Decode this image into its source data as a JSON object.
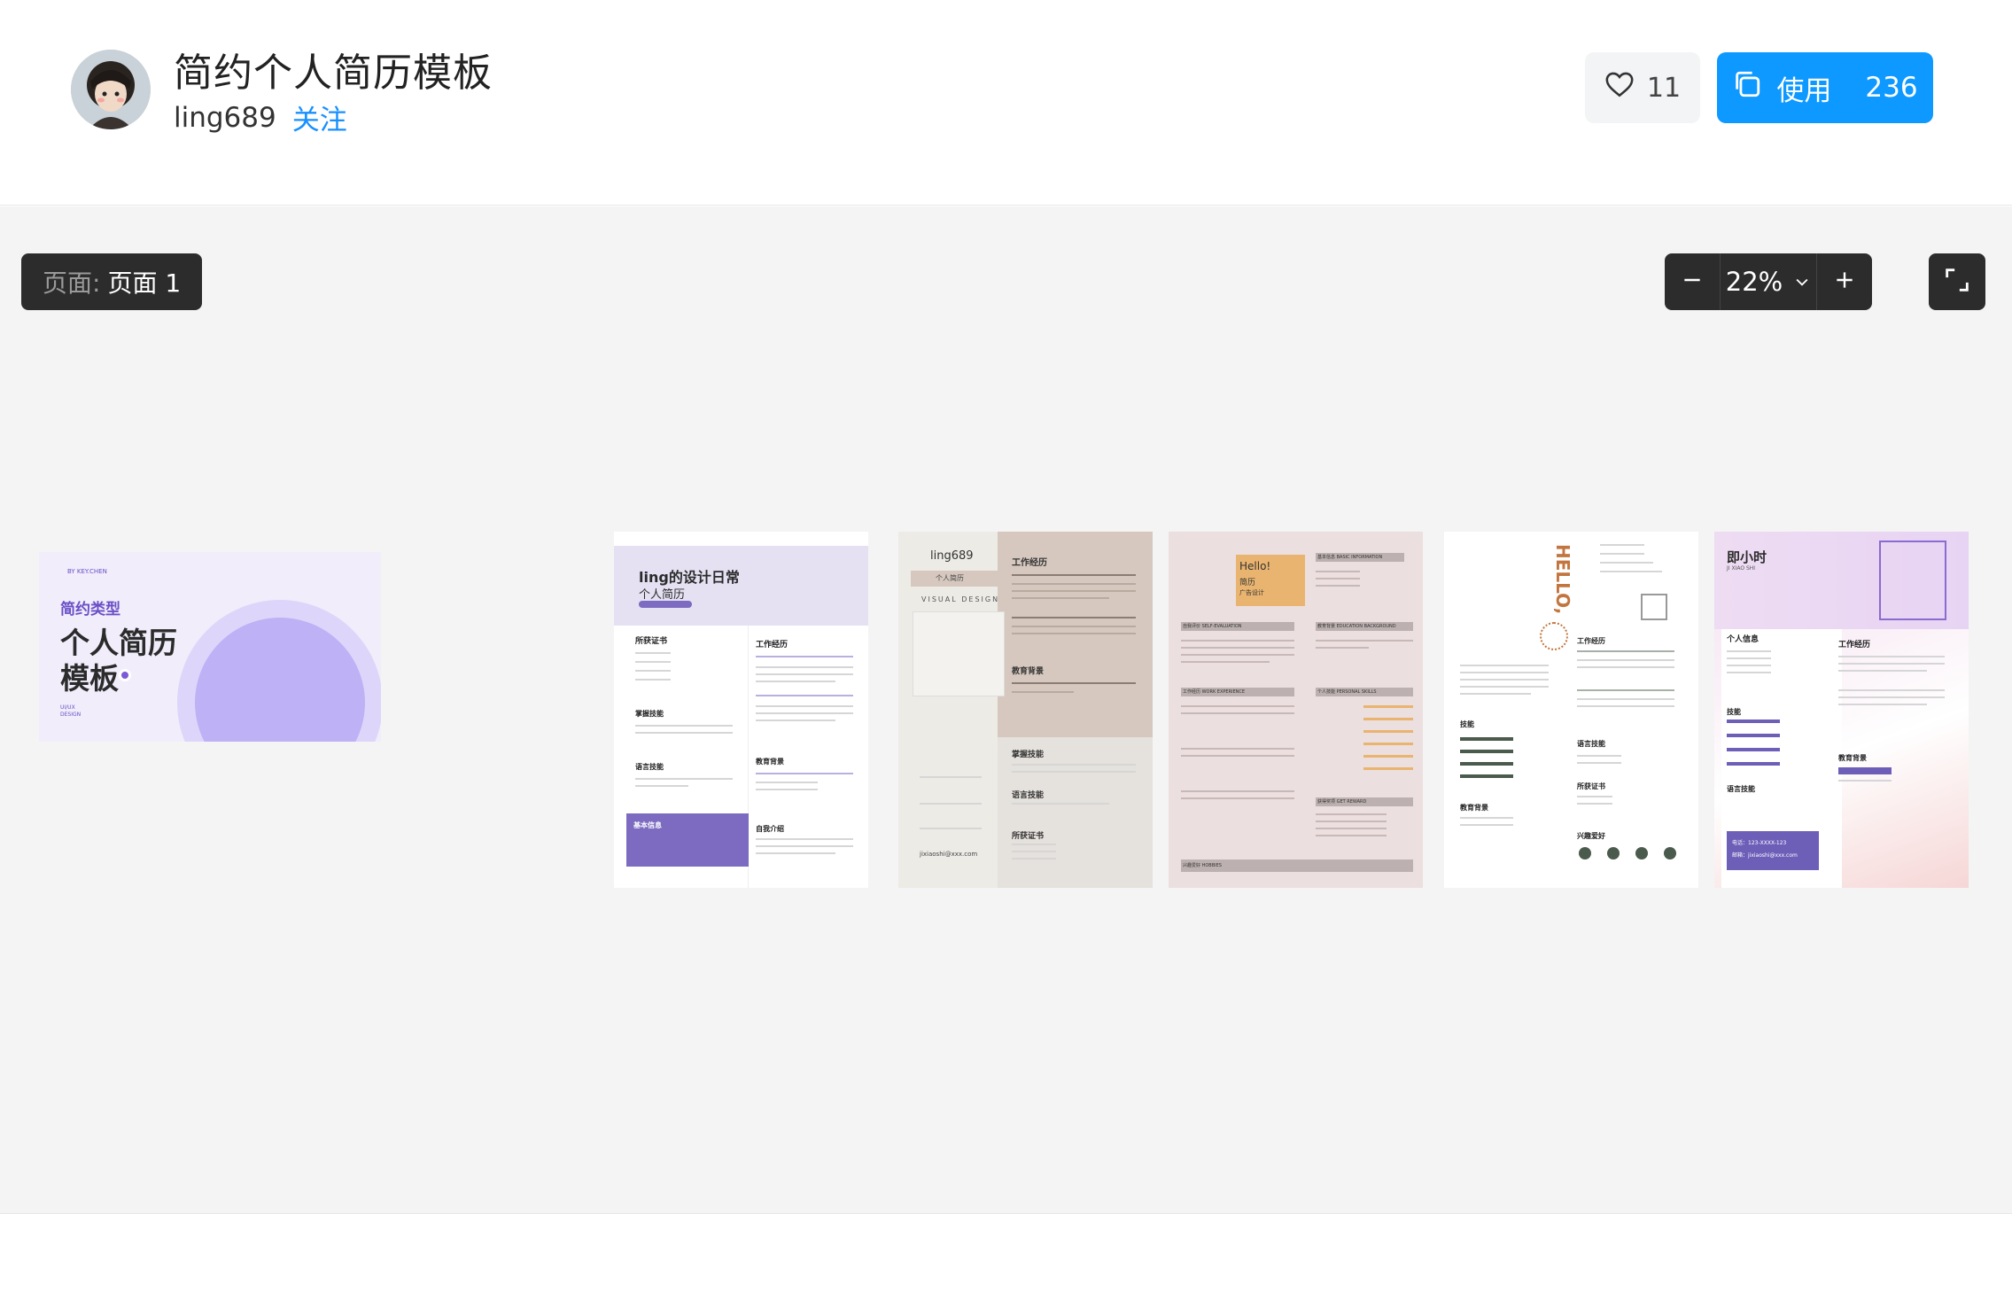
{
  "header": {
    "title": "简约个人简历模板",
    "author": "ling689",
    "follow_label": "关注",
    "like_count": "11",
    "use_label": "使用",
    "use_count": "236"
  },
  "toolbar": {
    "page_label": "页面:",
    "page_value": "页面 1",
    "zoom_value": "22%"
  },
  "colors": {
    "accent": "#0d99ff",
    "dark_control": "#2c2c2c",
    "canvas_bg": "#f4f4f4",
    "purple": "#7c5cd6"
  },
  "icons": {
    "like": "heart-icon",
    "use": "copy-icon",
    "zoom_out": "minus-icon",
    "zoom_in": "plus-icon",
    "zoom_menu": "chevron-down-icon",
    "fullscreen": "expand-icon"
  },
  "pages": {
    "cover": {
      "tag": "BY KEY.CHEN",
      "subtitle": "简约类型",
      "title_line1": "个人简历",
      "title_line2": "模板",
      "foot1": "UI/UX",
      "foot2": "DESIGN"
    },
    "resume1": {
      "title": "ling的设计日常",
      "subtitle": "个人简历",
      "sec_cert": "所获证书",
      "sec_work": "工作经历",
      "sec_skill": "掌握技能",
      "sec_lang": "语言技能",
      "sec_edu": "教育背景",
      "sec_info": "基本信息",
      "sec_intro": "自我介绍"
    },
    "resume2": {
      "name": "ling689",
      "role": "个人简历",
      "tag": "VISUAL DESIGN",
      "sec_work": "工作经历",
      "sec_edu": "教育背景",
      "sec_skill": "掌握技能",
      "sec_lang": "语言技能",
      "sec_cert": "所获证书",
      "email": "jixiaoshi@xxx.com"
    },
    "resume3": {
      "hello": "Hello!",
      "sub": "简历",
      "sub2": "广告设计",
      "sec_basic": "基本信息 BASIC INFORMATION",
      "sec_self": "自我评价 SELF-EVALUATION",
      "sec_edu": "教育背景 EDUCATION BACKGROUND",
      "sec_work": "工作经历 WORK EXPERIENCE",
      "sec_skill": "个人技能 PERSONAL SKILLS",
      "sec_reward": "获得奖项 GET REWARD",
      "sec_hobby": "兴趣爱好 HOBBIES"
    },
    "resume4": {
      "hello": "HELLO,",
      "sec_work": "工作经历",
      "sec_skill": "技能",
      "sec_lang": "语言技能",
      "sec_edu": "教育背景",
      "sec_cert": "所获证书",
      "sec_hobby": "兴趣爱好"
    },
    "resume5": {
      "name": "即小时",
      "name_en": "JI XIAO SHI",
      "sec_info": "个人信息",
      "sec_work": "工作经历",
      "sec_skill": "技能",
      "sec_lang": "语言技能",
      "sec_edu": "教育背景",
      "phone": "电话：123-XXXX-123",
      "email": "邮箱：jixiaoshi@xxx.com"
    }
  }
}
